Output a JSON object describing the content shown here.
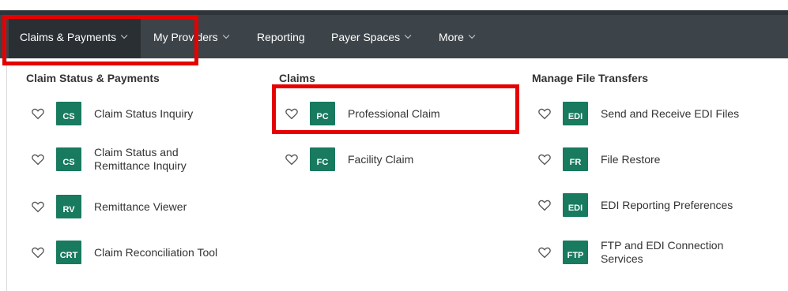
{
  "nav": {
    "items": [
      {
        "label": "Claims & Payments",
        "dropdown": true,
        "active": true
      },
      {
        "label": "My Providers",
        "dropdown": true
      },
      {
        "label": "Reporting",
        "dropdown": false
      },
      {
        "label": "Payer Spaces",
        "dropdown": true
      },
      {
        "label": "More",
        "dropdown": true
      }
    ]
  },
  "columns": [
    {
      "heading": "Claim Status & Payments",
      "items": [
        {
          "badge": "CS",
          "label": "Claim Status Inquiry"
        },
        {
          "badge": "CS",
          "label": "Claim Status and Remittance Inquiry"
        },
        {
          "badge": "RV",
          "label": "Remittance Viewer"
        },
        {
          "badge": "CRT",
          "label": "Claim Reconciliation Tool"
        }
      ]
    },
    {
      "heading": "Claims",
      "items": [
        {
          "badge": "PC",
          "label": "Professional Claim"
        },
        {
          "badge": "FC",
          "label": "Facility Claim"
        }
      ]
    },
    {
      "heading": "Manage File Transfers",
      "items": [
        {
          "badge": "EDI",
          "label": "Send and Receive EDI Files"
        },
        {
          "badge": "FR",
          "label": "File Restore"
        },
        {
          "badge": "EDI",
          "label": "EDI Reporting Preferences"
        },
        {
          "badge": "FTP",
          "label": "FTP and EDI Connection Services"
        }
      ]
    }
  ],
  "colors": {
    "navbar": "#3d4449",
    "nav_active": "#2a2f33",
    "badge": "#187a5e",
    "annotation": "#e60000"
  }
}
